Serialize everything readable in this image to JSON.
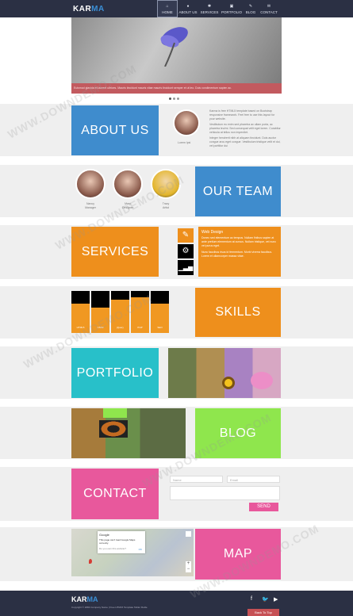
{
  "nav": {
    "logo_main": "KAR",
    "logo_accent": "MA",
    "items": [
      {
        "label": "HOME"
      },
      {
        "label": "ABOUT US"
      },
      {
        "label": "SERVICES"
      },
      {
        "label": "PORTFOLIO"
      },
      {
        "label": "BLOG"
      },
      {
        "label": "CONTACT"
      }
    ]
  },
  "hero": {
    "caption": "Euismod glavida et laoreet ultrices. Mauris tincidunt mauris vitae mauris tincidunt semper et ut leo. Duis condimentum sapien ac."
  },
  "about": {
    "title": "ABOUT US",
    "person_name": "Lorem Ipsi",
    "p1": "Karma is free HTML5 template based on Bootstrap responsive framework. Feel free to use this layout for your website.",
    "p2": "Vestibulum eu enim sed pharetra ac ullam porta, ac pharetra leo/mi. Sed consequat velit eget lorem. Curabitur vehicula at tellus non imperdiet.",
    "p3": "Integer hendrerit nibh at aliquam tincidunt. Duis auctor congue arcu eget congue. Vestibulum tristique velit et dui, vel porttitor dui"
  },
  "team": {
    "title": "OUR TEAM",
    "members": [
      {
        "name": "Nancy",
        "role": "Manager"
      },
      {
        "name": "Mary",
        "role": "Designer"
      },
      {
        "name": "Tracy",
        "role": "Artist"
      }
    ]
  },
  "services": {
    "title": "SERVICES",
    "panel_title": "Web Design",
    "panel_text": "Donec sed elementum ac tempus. Nullam finibus sapien at ante pretium elementum at cursus. Nullam tristique, vel nunc vel purus eget.",
    "panel_text2": "Nunc faucibus risus id fermentum. Morbi viverra faucibus. Lorem et ullamcorper massa vitae."
  },
  "skills": {
    "title": "SKILLS",
    "bars": [
      {
        "name": "HTML5",
        "percent": 70
      },
      {
        "name": "CSS3",
        "percent": 60
      },
      {
        "name": "jQuery",
        "percent": 80
      },
      {
        "name": "PHP",
        "percent": 85
      },
      {
        "name": "SEO",
        "percent": 70
      }
    ]
  },
  "portfolio": {
    "title": "PORTFOLIO"
  },
  "blog": {
    "title": "BLOG"
  },
  "contact": {
    "title": "CONTACT",
    "name_placeholder": "Name",
    "email_placeholder": "Email",
    "send_label": "SEND"
  },
  "map_section": {
    "title": "MAP",
    "popup_title": "Google",
    "popup_text": "This page can't load Google Maps correctly.",
    "popup_sub": "Do you own this website?",
    "popup_ok": "OK"
  },
  "footer": {
    "logo_main": "KAR",
    "logo_accent": "MA",
    "copyright": "Copyright © 2084 Company Name | Free HTML5 Template Tabler Retile",
    "to_top": "Back To Top"
  },
  "watermark": "WWW.DOWNDEMO.COM",
  "colors": {
    "nav": "#2b3044",
    "blue": "#3f8ccd",
    "orange": "#ee8f1c",
    "teal": "#28c0c9",
    "lime": "#8fe64d",
    "pink": "#e8589c"
  }
}
